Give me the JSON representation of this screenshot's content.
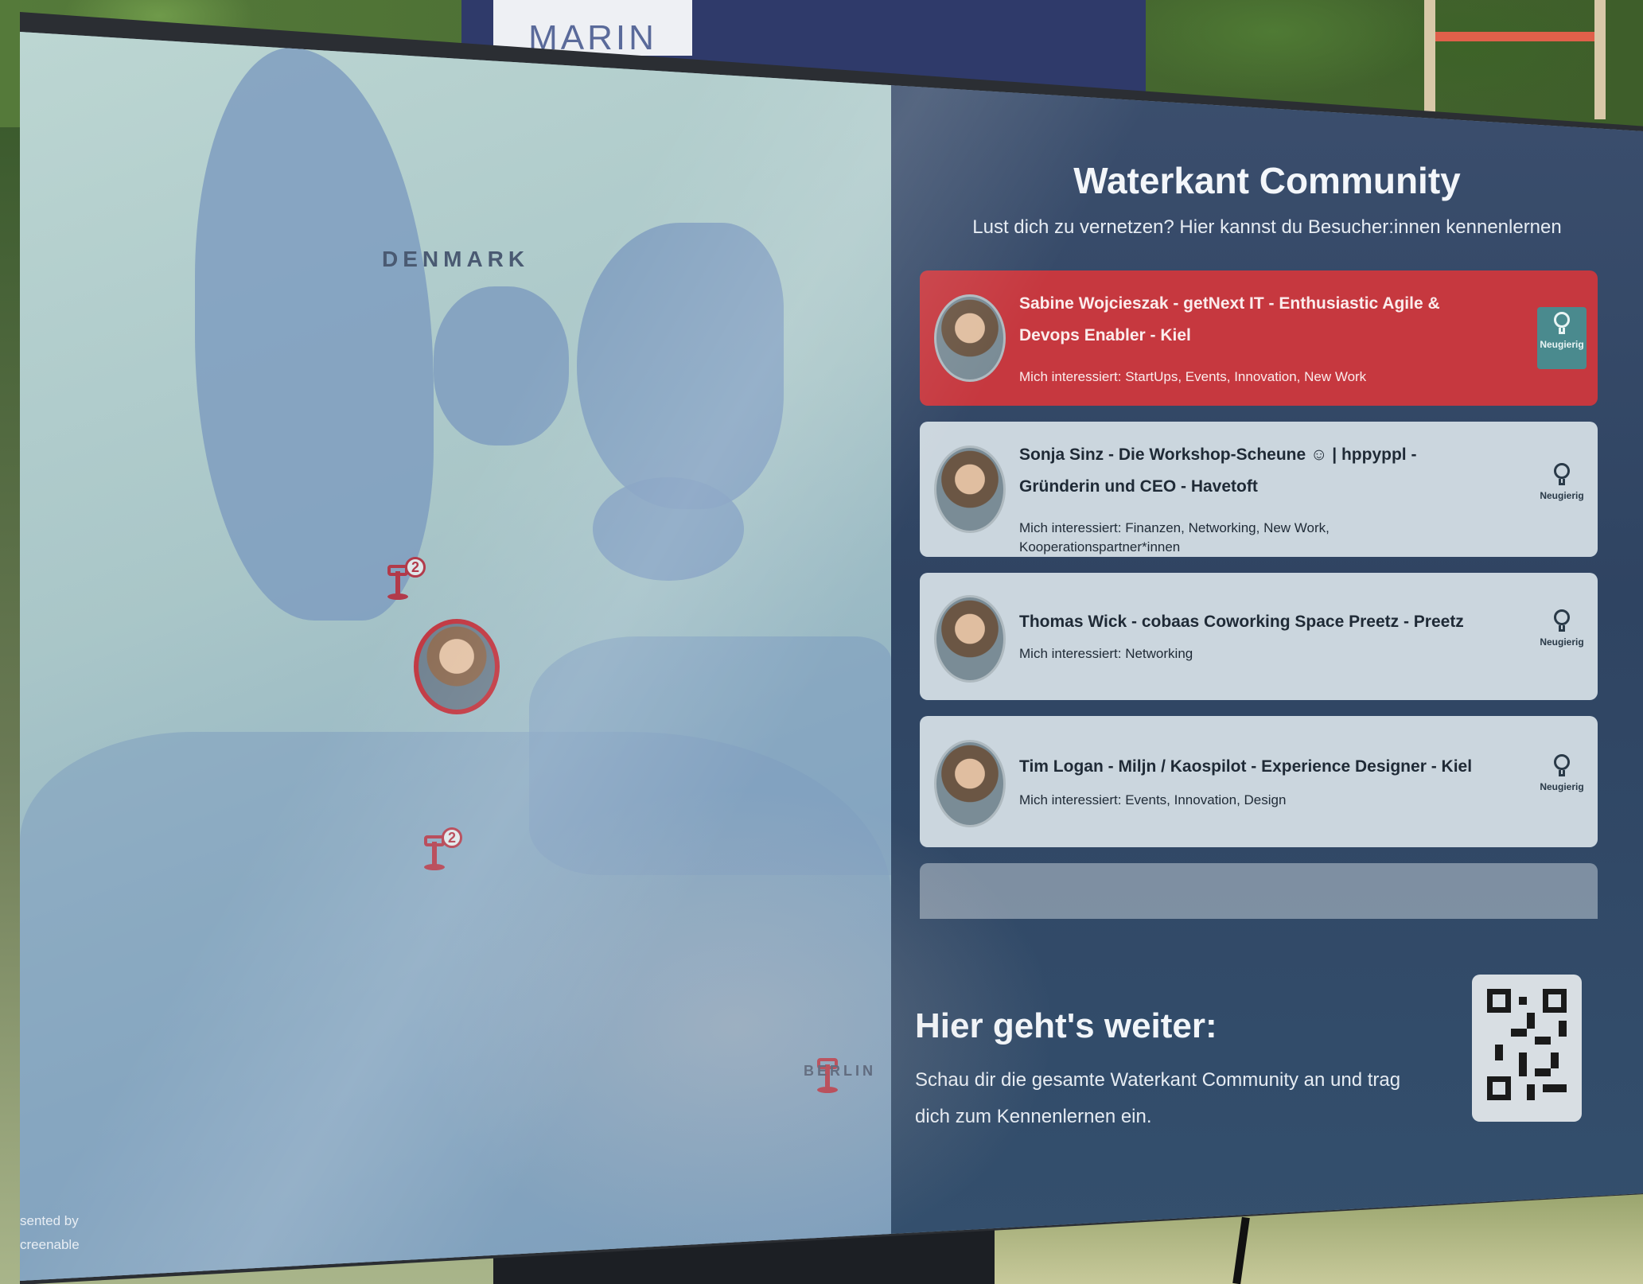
{
  "background": {
    "banner_text": "MARIN"
  },
  "map": {
    "country_label": "DENMARK",
    "city_label": "BERLIN",
    "pins": [
      {
        "count": "2"
      },
      {
        "count": "2"
      }
    ],
    "presented_by": "sented by",
    "presented_brand": "creenable",
    "colors": {
      "pin": "#b23a4a",
      "water": "#a9c6c8",
      "land": "#7f9ec0"
    }
  },
  "panel": {
    "title": "Waterkant Community",
    "subtitle": "Lust dich zu vernetzen? Hier kannst du Besucher:innen kennenlernen",
    "cards": [
      {
        "title": "Sabine Wojcieszak - getNext IT - Enthusiastic Agile & Devops Enabler - Kiel",
        "interest": "Mich interessiert: StartUps, Events, Innovation, New Work",
        "badge": "Neugierig",
        "active": true
      },
      {
        "title": "Sonja Sinz - Die Workshop-Scheune ☺ | hppyppl - Gründerin und CEO - Havetoft",
        "interest": "Mich interessiert: Finanzen, Networking, New Work, Kooperationspartner*innen",
        "badge": "Neugierig",
        "active": false
      },
      {
        "title": "Thomas Wick - cobaas Coworking Space Preetz - Preetz",
        "interest": "Mich interessiert: Networking",
        "badge": "Neugierig",
        "active": false
      },
      {
        "title": "Tim Logan - Miljn / Kaospilot - Experience Designer - Kiel",
        "interest": "Mich interessiert: Events, Innovation, Design",
        "badge": "Neugierig",
        "active": false
      }
    ],
    "bottom_title": "Hier geht's weiter:",
    "bottom_text": "Schau dir die gesamte Waterkant Community an und trag dich zum Kennenlernen ein.",
    "colors": {
      "active_card": "#c6383f",
      "card": "#cbd6de",
      "panel": "#2f4462",
      "badge": "#4a8a8e"
    }
  }
}
